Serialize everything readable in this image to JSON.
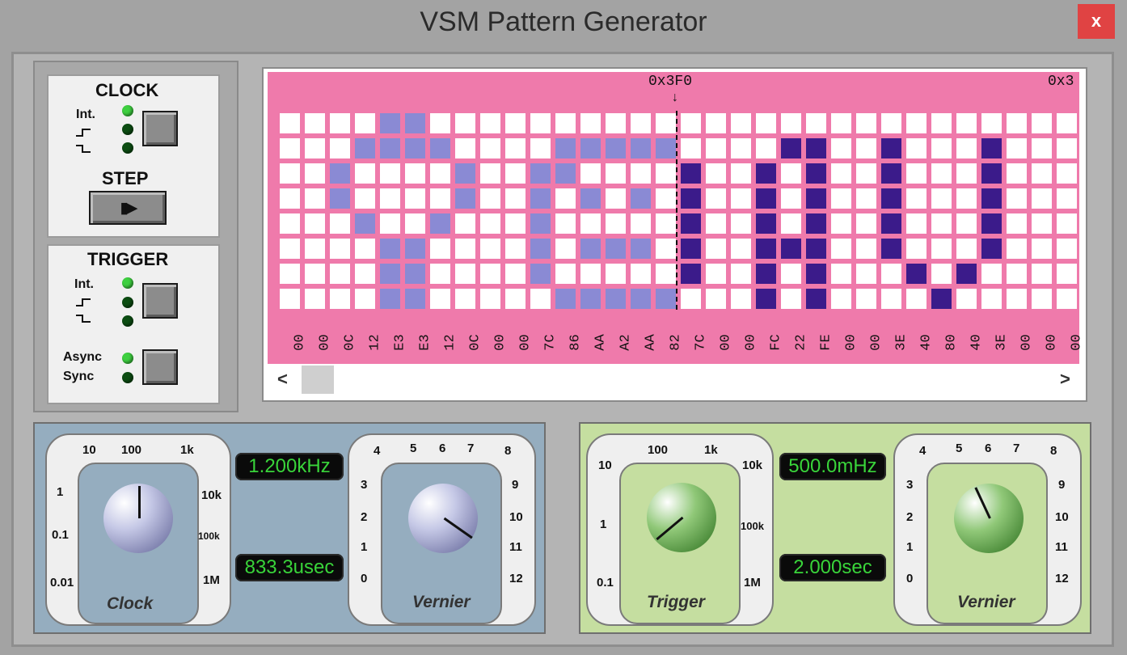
{
  "window": {
    "title": "VSM Pattern Generator",
    "close_label": "x"
  },
  "clock_panel": {
    "title": "CLOCK",
    "int_label": "Int.",
    "step_title": "STEP",
    "step_glyph": "▮▶"
  },
  "trigger_panel": {
    "title": "TRIGGER",
    "int_label": "Int.",
    "async_label": "Async",
    "sync_label": "Sync"
  },
  "pattern": {
    "cursor_address": "0x3F0",
    "next_address": "0x3",
    "bytes": [
      "00",
      "00",
      "0C",
      "12",
      "E3",
      "E3",
      "12",
      "0C",
      "00",
      "00",
      "7C",
      "86",
      "AA",
      "A2",
      "AA",
      "82",
      "7C",
      "00",
      "00",
      "FC",
      "22",
      "FE",
      "00",
      "00",
      "3E",
      "40",
      "80",
      "40",
      "3E",
      "00",
      "00",
      "00"
    ],
    "cursor_index": 16,
    "scroll_left": "<",
    "scroll_right": ">"
  },
  "clock_controls": {
    "range_ticks": [
      "10",
      "100",
      "1k",
      "10k",
      "100k",
      "1M",
      "0.01",
      "0.1",
      "1"
    ],
    "dial_label": "Clock",
    "frequency_display": "1.200kHz",
    "period_display": "833.3usec",
    "vernier_ticks": [
      "0",
      "1",
      "2",
      "3",
      "4",
      "5",
      "6",
      "7",
      "8",
      "9",
      "10",
      "11",
      "12"
    ],
    "vernier_label": "Vernier"
  },
  "trigger_controls": {
    "range_ticks": [
      "10",
      "100",
      "1k",
      "10k",
      "100k",
      "1M",
      "0.1",
      "1"
    ],
    "dial_label": "Trigger",
    "frequency_display": "500.0mHz",
    "period_display": "2.000sec",
    "vernier_ticks": [
      "0",
      "1",
      "2",
      "3",
      "4",
      "5",
      "6",
      "7",
      "8",
      "9",
      "10",
      "11",
      "12"
    ],
    "vernier_label": "Vernier"
  },
  "colors": {
    "pattern_bg": "#ef7aab",
    "bit_light": "#8a8ad4",
    "bit_dark": "#3b1b8a",
    "clock_panel": "#95adbf",
    "trigger_panel": "#c5dea0",
    "display_text": "#39d43a",
    "close_button": "#e04343"
  }
}
